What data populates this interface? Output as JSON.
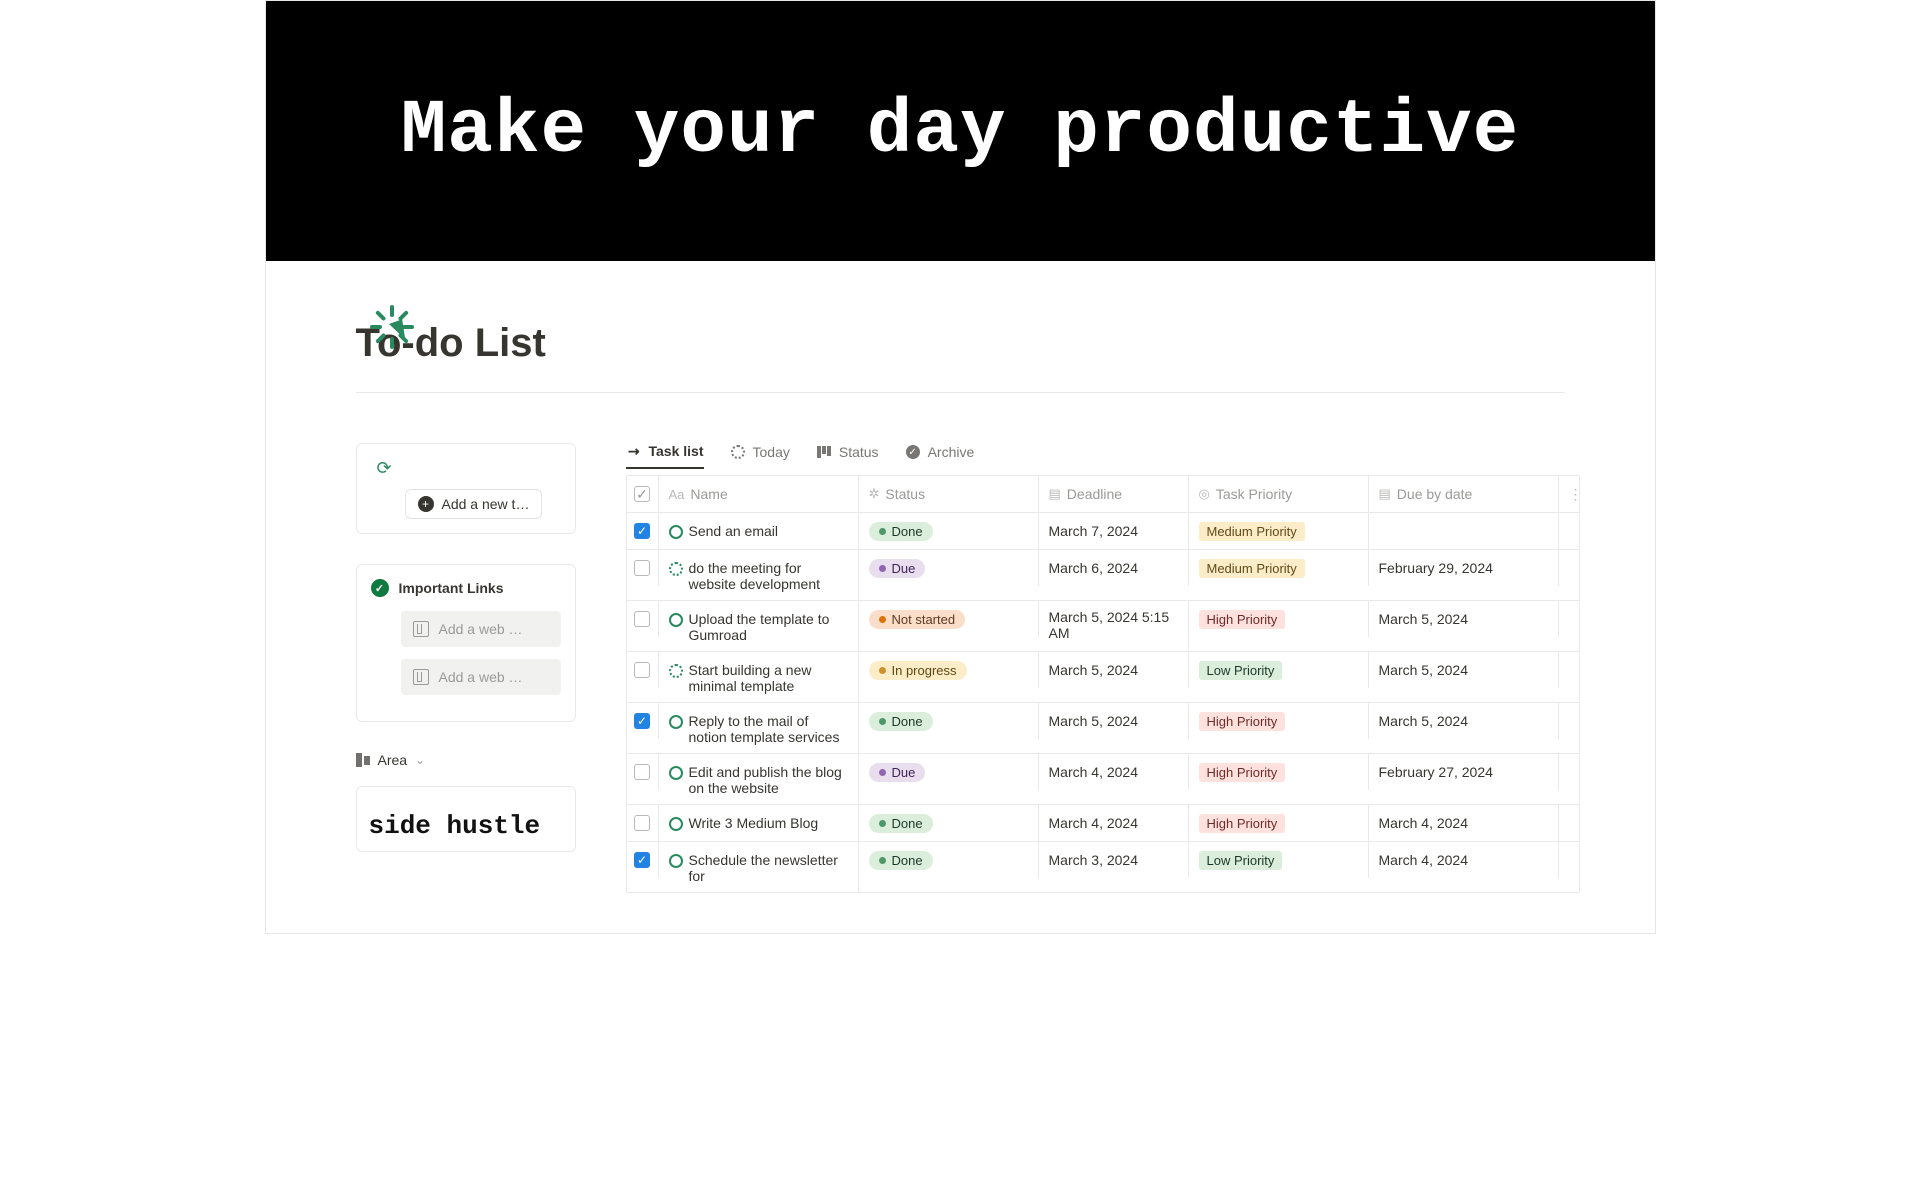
{
  "banner": {
    "text": "Make your day productive"
  },
  "page": {
    "title": "To-do List"
  },
  "sidebar": {
    "new_task_label": "Add a new t…",
    "links_title": "Important Links",
    "bookmark_placeholder_1": "Add a web …",
    "bookmark_placeholder_2": "Add a web …",
    "area_label": "Area",
    "hustle_card_text": "side hustle"
  },
  "tabs": [
    {
      "label": "Task list",
      "icon": "arrow"
    },
    {
      "label": "Today",
      "icon": "dotted"
    },
    {
      "label": "Status",
      "icon": "bars"
    },
    {
      "label": "Archive",
      "icon": "arch"
    }
  ],
  "columns": {
    "name": "Name",
    "status": "Status",
    "deadline": "Deadline",
    "priority": "Task Priority",
    "due": "Due by date"
  },
  "rows": [
    {
      "checked": true,
      "dotted": false,
      "name": "Send an email",
      "status": "Done",
      "status_cls": "done",
      "deadline": "March 7, 2024",
      "priority": "Medium Priority",
      "priority_cls": "med",
      "due": ""
    },
    {
      "checked": false,
      "dotted": true,
      "name": "do the meeting for website development",
      "status": "Due",
      "status_cls": "due",
      "deadline": "March 6, 2024",
      "priority": "Medium Priority",
      "priority_cls": "med",
      "due": "February 29, 2024"
    },
    {
      "checked": false,
      "dotted": false,
      "name": "Upload the template to Gumroad",
      "status": "Not started",
      "status_cls": "ns",
      "deadline": "March 5, 2024 5:15 AM",
      "priority": "High Priority",
      "priority_cls": "high",
      "due": "March 5, 2024"
    },
    {
      "checked": false,
      "dotted": true,
      "name": "Start building a new minimal template",
      "status": "In progress",
      "status_cls": "ip",
      "deadline": "March 5, 2024",
      "priority": "Low Priority",
      "priority_cls": "low",
      "due": "March 5, 2024"
    },
    {
      "checked": true,
      "dotted": false,
      "name": "Reply to the mail of notion template services",
      "status": "Done",
      "status_cls": "done",
      "deadline": "March 5, 2024",
      "priority": "High Priority",
      "priority_cls": "high",
      "due": "March 5, 2024"
    },
    {
      "checked": false,
      "dotted": false,
      "name": "Edit and publish the blog on the website",
      "status": "Due",
      "status_cls": "due",
      "deadline": "March 4, 2024",
      "priority": "High Priority",
      "priority_cls": "high",
      "due": "February 27, 2024"
    },
    {
      "checked": false,
      "dotted": false,
      "name": "Write 3 Medium Blog",
      "status": "Done",
      "status_cls": "done",
      "deadline": "March 4, 2024",
      "priority": "High Priority",
      "priority_cls": "high",
      "due": "March 4, 2024"
    },
    {
      "checked": true,
      "dotted": false,
      "name": "Schedule the newsletter for",
      "status": "Done",
      "status_cls": "done",
      "deadline": "March 3, 2024",
      "priority": "Low Priority",
      "priority_cls": "low",
      "due": "March 4, 2024"
    }
  ]
}
